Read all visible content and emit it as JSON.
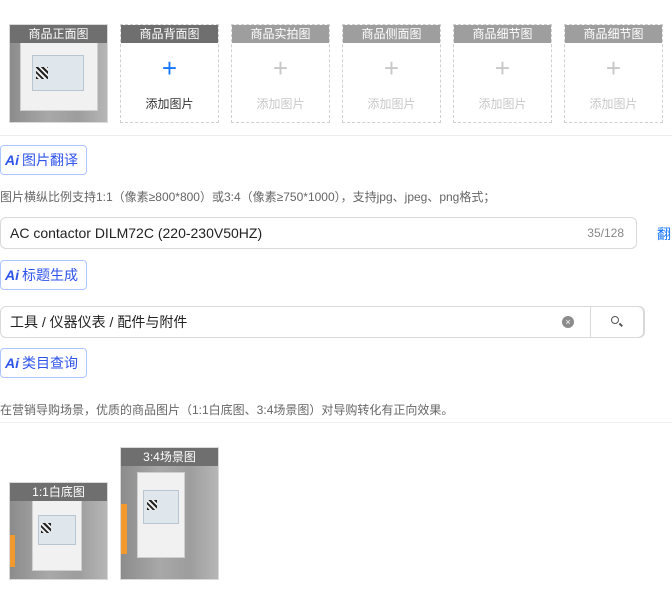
{
  "image_slots": [
    {
      "title": "商品正面图",
      "has_image": true
    },
    {
      "title": "商品背面图",
      "add_label": "添加图片",
      "plus": "+"
    },
    {
      "title": "商品实拍图",
      "add_label": "添加图片",
      "plus": "+"
    },
    {
      "title": "商品侧面图",
      "add_label": "添加图片",
      "plus": "+"
    },
    {
      "title": "商品细节图",
      "add_label": "添加图片",
      "plus": "+"
    },
    {
      "title": "商品细节图",
      "add_label": "添加图片",
      "plus": "+"
    }
  ],
  "image_translate": {
    "ai_badge": "Ai",
    "label": "图片翻译"
  },
  "image_hint": "图片横纵比例支持1:1（像素≥800*800）或3:4（像素≥750*1000），支持jpg、jpeg、png格式；",
  "title_field": {
    "value": "AC contactor DILM72C (220-230V50HZ)",
    "counter": "35/128",
    "side_link": "翻"
  },
  "title_generate": {
    "ai_badge": "Ai",
    "label": "标题生成"
  },
  "category_field": {
    "value": "工具 / 仪器仪表 / 配件与附件",
    "clear_glyph": "×"
  },
  "category_query": {
    "ai_badge": "Ai",
    "label": "类目查询"
  },
  "marketing_hint": "在营销导购场景，优质的商品图片（1:1白底图、3:4场景图）对导购转化有正向效果。",
  "marketing_images": [
    {
      "title": "1:1白底图"
    },
    {
      "title": "3:4场景图"
    }
  ]
}
